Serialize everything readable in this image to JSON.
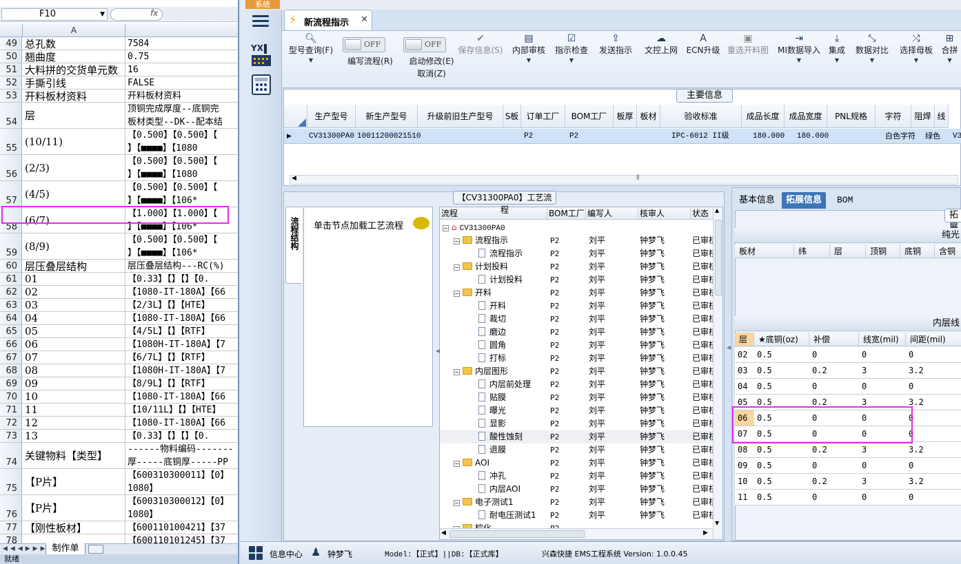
{
  "excel": {
    "name_box": "F10",
    "fx": "fx",
    "col_a": "A",
    "rows": [
      {
        "n": "49",
        "a": "总孔数",
        "b": "7584"
      },
      {
        "n": "50",
        "a": "翘曲度",
        "b": "0.75"
      },
      {
        "n": "51",
        "a": "大料拼的交货单元数",
        "b": "16"
      },
      {
        "n": "52",
        "a": "手撕引线",
        "b": "FALSE"
      },
      {
        "n": "53",
        "a": "开料板材资料",
        "b": "开料板材资料"
      },
      {
        "n": "54",
        "a": "层",
        "b": "顶铜完成厚度--底铜完\n板材类型--DK--配本结"
      },
      {
        "n": "55",
        "a": "(10/11)",
        "b": "【0.500】【0.500】【\n】【■■■■】【1080"
      },
      {
        "n": "56",
        "a": "(2/3)",
        "b": "【0.500】【0.500】【\n】【■■■■】【1080"
      },
      {
        "n": "57",
        "a": "(4/5)",
        "b": "【0.500】【0.500】【\n】【■■■■】【106*"
      },
      {
        "n": "58",
        "a": "(6/7)",
        "b": "【1.000】【1.000】【\n】【■■■■】【106*"
      },
      {
        "n": "59",
        "a": "(8/9)",
        "b": "【0.500】【0.500】【\n】【■■■■】【106*"
      },
      {
        "n": "60",
        "a": "层压叠层结构",
        "b": "层压叠层结构---RC(%)"
      },
      {
        "n": "61",
        "a": "01",
        "b": "【0.33】【】【】【0."
      },
      {
        "n": "62",
        "a": "02",
        "b": "【1080-IT-180A】【66"
      },
      {
        "n": "63",
        "a": "03",
        "b": "【2/3L】【】【HTE】"
      },
      {
        "n": "64",
        "a": "04",
        "b": "【1080-IT-180A】【66"
      },
      {
        "n": "65",
        "a": "05",
        "b": "【4/5L】【】【RTF】"
      },
      {
        "n": "66",
        "a": "06",
        "b": "【1080H-IT-180A】【7"
      },
      {
        "n": "67",
        "a": "07",
        "b": "【6/7L】【】【RTF】"
      },
      {
        "n": "68",
        "a": "08",
        "b": "【1080H-IT-180A】【7"
      },
      {
        "n": "69",
        "a": "09",
        "b": "【8/9L】【】【RTF】"
      },
      {
        "n": "70",
        "a": "10",
        "b": "【1080-IT-180A】【66"
      },
      {
        "n": "71",
        "a": "11",
        "b": "【10/11L】【】【HTE】"
      },
      {
        "n": "72",
        "a": "12",
        "b": "【1080-IT-180A】【66"
      },
      {
        "n": "73",
        "a": "13",
        "b": "【0.33】【】【】【0."
      },
      {
        "n": "74",
        "a": "关键物料【类型】",
        "b": "------物料编码-------\n厚-----底铜厚-----PP"
      },
      {
        "n": "75",
        "a": "【P片】",
        "b": "【600310300011】【0】\n1080】"
      },
      {
        "n": "76",
        "a": "【P片】",
        "b": "【600310300012】【0】\n1080】"
      },
      {
        "n": "77",
        "a": "【刚性板材】",
        "b": "【600110100421】【37"
      },
      {
        "n": "78",
        "a": "",
        "b": "【600110101245】【37"
      }
    ],
    "sheet_tab": "制作单",
    "status": "就绪",
    "sys_button": "系统"
  },
  "app": {
    "doc_tab": "新流程指示",
    "toolbar": {
      "type_query": "型号查询(F)",
      "off1": "OFF",
      "write_flow": "编写流程(R)",
      "off2": "OFF",
      "start_modify": "启动修改(E)",
      "cancel_modify": "取消(Z)",
      "save_info": "保存信息(S)",
      "internal_review": "内部审核",
      "instr_check": "指示检查",
      "send_instr": "发送指示",
      "upload": "文控上网",
      "ecn": "ECN升级",
      "reselect": "重选开料图",
      "mi_import": "MI数据导入",
      "integrate": "集成",
      "compare": "数据对比",
      "select_mother": "选择母板",
      "merge": "合拼"
    },
    "main_info": {
      "title": "主要信息",
      "headers": [
        "生产型号",
        "新生产型号",
        "升级前旧生产型号",
        "S板",
        "订单工厂",
        "BOM工厂",
        "板厚",
        "板材",
        "验收标准",
        "成品长度",
        "成品宽度",
        "PNL规格",
        "字符",
        "阻焊",
        "线"
      ],
      "row": {
        "prod_no": "CV31300PA0",
        "new_prod_no": "10011200021510",
        "order_factory": "P2",
        "bom_factory": "P2",
        "standard": "IPC-6012 II级",
        "length": "180.000",
        "width": "180.000",
        "char": "白色字符",
        "mask": "绿色",
        "extra": "V3"
      }
    },
    "flow": {
      "title": "【CV31300PA0】工艺流程",
      "side_tab": "流程结构",
      "load_hint": "单击节点加载工艺流程",
      "headers": [
        "流程",
        "BOM工厂",
        "编写人",
        "核审人",
        "状态"
      ],
      "root": "CV31300PA0",
      "rows": [
        {
          "level": 1,
          "name": "流程指示",
          "bom": "P2",
          "writer": "刘平",
          "reviewer": "钟梦飞",
          "status": "已审核"
        },
        {
          "level": 2,
          "name": "流程指示",
          "bom": "P2",
          "writer": "刘平",
          "reviewer": "钟梦飞",
          "status": "已审核"
        },
        {
          "level": 1,
          "name": "计划投料",
          "bom": "P2",
          "writer": "刘平",
          "reviewer": "钟梦飞",
          "status": "已审核"
        },
        {
          "level": 2,
          "name": "计划投料",
          "bom": "P2",
          "writer": "刘平",
          "reviewer": "钟梦飞",
          "status": "已审核"
        },
        {
          "level": 1,
          "name": "开料",
          "bom": "P2",
          "writer": "刘平",
          "reviewer": "钟梦飞",
          "status": "已审核"
        },
        {
          "level": 2,
          "name": "开料",
          "bom": "P2",
          "writer": "刘平",
          "reviewer": "钟梦飞",
          "status": "已审核"
        },
        {
          "level": 2,
          "name": "裁切",
          "bom": "P2",
          "writer": "刘平",
          "reviewer": "钟梦飞",
          "status": "已审核"
        },
        {
          "level": 2,
          "name": "磨边",
          "bom": "P2",
          "writer": "刘平",
          "reviewer": "钟梦飞",
          "status": "已审核"
        },
        {
          "level": 2,
          "name": "圆角",
          "bom": "P2",
          "writer": "刘平",
          "reviewer": "钟梦飞",
          "status": "已审核"
        },
        {
          "level": 2,
          "name": "打标",
          "bom": "P2",
          "writer": "刘平",
          "reviewer": "钟梦飞",
          "status": "已审核"
        },
        {
          "level": 1,
          "name": "内层图形",
          "bom": "P2",
          "writer": "刘平",
          "reviewer": "钟梦飞",
          "status": "已审核"
        },
        {
          "level": 2,
          "name": "内层前处理",
          "bom": "P2",
          "writer": "刘平",
          "reviewer": "钟梦飞",
          "status": "已审核"
        },
        {
          "level": 2,
          "name": "贴膜",
          "bom": "P2",
          "writer": "刘平",
          "reviewer": "钟梦飞",
          "status": "已审核"
        },
        {
          "level": 2,
          "name": "曝光",
          "bom": "P2",
          "writer": "刘平",
          "reviewer": "钟梦飞",
          "status": "已审核"
        },
        {
          "level": 2,
          "name": "显影",
          "bom": "P2",
          "writer": "刘平",
          "reviewer": "钟梦飞",
          "status": "已审核"
        },
        {
          "level": 2,
          "name": "酸性蚀刻",
          "bom": "P2",
          "writer": "刘平",
          "reviewer": "钟梦飞",
          "status": "已审核"
        },
        {
          "level": 2,
          "name": "退膜",
          "bom": "P2",
          "writer": "刘平",
          "reviewer": "钟梦飞",
          "status": "已审核"
        },
        {
          "level": 1,
          "name": "AOI",
          "bom": "P2",
          "writer": "刘平",
          "reviewer": "钟梦飞",
          "status": "已审核"
        },
        {
          "level": 2,
          "name": "冲孔",
          "bom": "P2",
          "writer": "刘平",
          "reviewer": "钟梦飞",
          "status": "已审核"
        },
        {
          "level": 2,
          "name": "内层AOI",
          "bom": "P2",
          "writer": "刘平",
          "reviewer": "钟梦飞",
          "status": "已审核"
        },
        {
          "level": 1,
          "name": "电子测试1",
          "bom": "P2",
          "writer": "刘平",
          "reviewer": "钟梦飞",
          "status": "已审核"
        },
        {
          "level": 2,
          "name": "耐电压测试1",
          "bom": "P2",
          "writer": "刘平",
          "reviewer": "钟梦飞",
          "status": "已审核"
        },
        {
          "level": 1,
          "name": "棕化",
          "bom": "P2",
          "writer": "",
          "reviewer": "",
          "status": ""
        }
      ]
    },
    "right": {
      "tabs": [
        "基本信息",
        "拓展信息",
        "BOM"
      ],
      "top_btn": "拓展",
      "sec1": "纯光",
      "sec1_headers": [
        "板材",
        "纬",
        "层",
        "顶铜",
        "底铜",
        "含铜"
      ],
      "sec2": "内层线",
      "layer_headers": [
        "层",
        "★底铜(oz)",
        "补偿",
        "线宽(mil)",
        "间距(mil)"
      ],
      "layers": [
        {
          "l": "02",
          "cu": "0.5",
          "comp": "0",
          "w": "0",
          "s": "0"
        },
        {
          "l": "03",
          "cu": "0.5",
          "comp": "0.2",
          "w": "3",
          "s": "3.2"
        },
        {
          "l": "04",
          "cu": "0.5",
          "comp": "0",
          "w": "0",
          "s": "0"
        },
        {
          "l": "05",
          "cu": "0.5",
          "comp": "0.2",
          "w": "3",
          "s": "3.2"
        },
        {
          "l": "06",
          "cu": "0.5",
          "comp": "0",
          "w": "0",
          "s": "0"
        },
        {
          "l": "07",
          "cu": "0.5",
          "comp": "0",
          "w": "0",
          "s": "0"
        },
        {
          "l": "08",
          "cu": "0.5",
          "comp": "0.2",
          "w": "3",
          "s": "3.2"
        },
        {
          "l": "09",
          "cu": "0.5",
          "comp": "0",
          "w": "0",
          "s": "0"
        },
        {
          "l": "10",
          "cu": "0.5",
          "comp": "0.2",
          "w": "3",
          "s": "3.2"
        },
        {
          "l": "11",
          "cu": "0.5",
          "comp": "0",
          "w": "0",
          "s": "0"
        }
      ]
    },
    "status": {
      "info_center": "信息中心",
      "user": "钟梦飞",
      "model": "Model:【正式】||DB:【正式库】",
      "system": "兴森快捷 EMS工程系统 Version: 1.0.0.45"
    },
    "colors": {
      "highlight": "#e22ee6",
      "tab_active": "#3c75b8"
    }
  }
}
